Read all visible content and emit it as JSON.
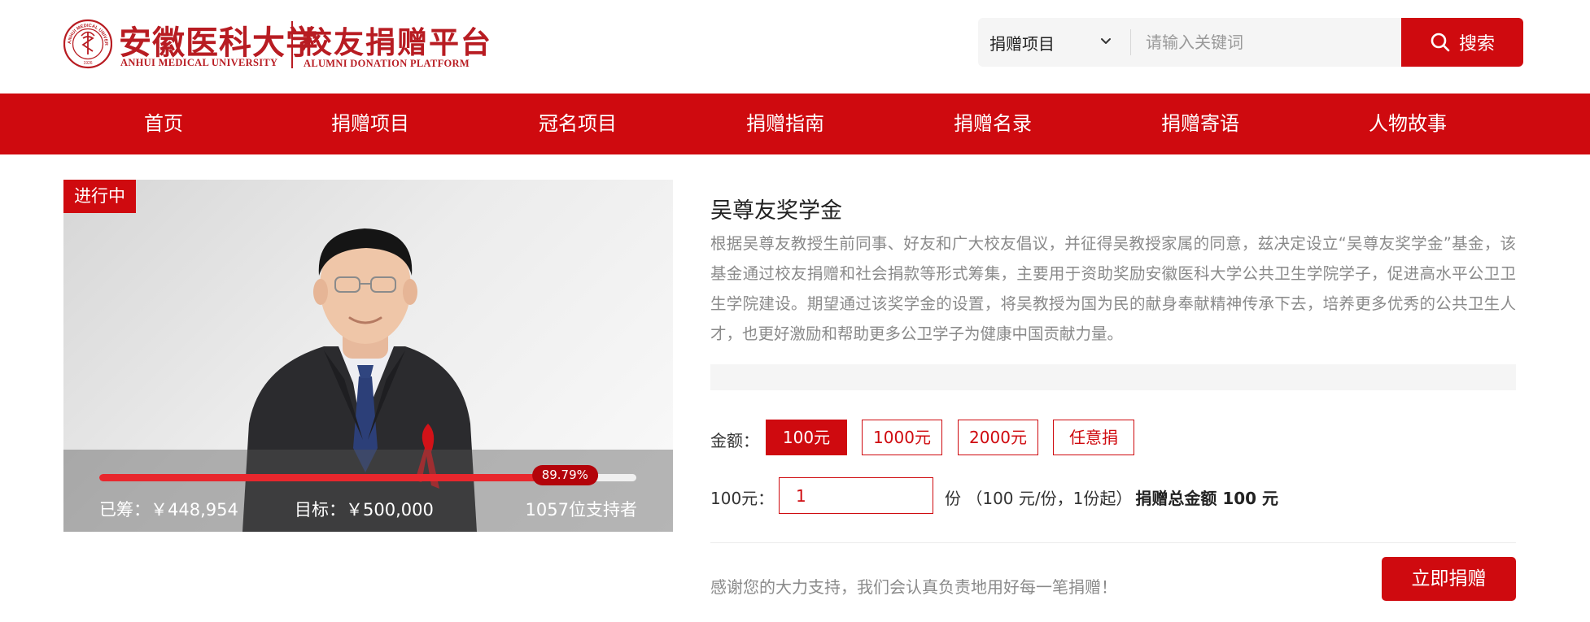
{
  "header": {
    "university_cn": "安徽医科大学",
    "university_en": "ANHUI MEDICAL UNIVERSITY",
    "platform_cn": "校友捐赠平台",
    "platform_en": "ALUMNI DONATION PLATFORM",
    "seal_ring_text": "ANHUI MEDICAL UNIVERSITY",
    "seal_year": "1926",
    "brand_color": "#b81c22"
  },
  "search": {
    "category_selected": "捐赠项目",
    "placeholder": "请输入关键词",
    "button_label": "搜索",
    "button_icon": "search-icon",
    "dropdown_icon": "chevron-down-icon"
  },
  "nav": {
    "items": [
      {
        "label": "首页"
      },
      {
        "label": "捐赠项目"
      },
      {
        "label": "冠名项目"
      },
      {
        "label": "捐赠指南"
      },
      {
        "label": "捐赠名录"
      },
      {
        "label": "捐赠寄语"
      },
      {
        "label": "人物故事"
      }
    ],
    "background_color": "#cf0a0f"
  },
  "project": {
    "status": "进行中",
    "progress_percent": 89.79,
    "progress_label": "89.79%",
    "raised": "已筹：￥448,954",
    "goal": "目标：￥500,000",
    "supporters": "1057位支持者",
    "title": "吴尊友奖学金",
    "description": "根据吴尊友教授生前同事、好友和广大校友倡议，并征得吴教授家属的同意，兹决定设立“吴尊友奖学金”基金，该基金通过校友捐赠和社会捐款等形式筹集，主要用于资助奖励安徽医科大学公共卫生学院学子，促进高水平公卫卫生学院建设。期望通过该奖学金的设置，将吴教授为国为民的献身奉献精神传承下去，培养更多优秀的公共卫生人才，也更好激励和帮助更多公卫学子为健康中国贡献力量。"
  },
  "donation": {
    "amount_label": "金额：",
    "options": [
      {
        "label": "100元",
        "selected": true
      },
      {
        "label": "1000元",
        "selected": false
      },
      {
        "label": "2000元",
        "selected": false
      },
      {
        "label": "任意捐",
        "selected": false
      }
    ],
    "unit_label": "100元：",
    "quantity_value": "1",
    "unit_suffix": "份 （100 元/份，1份起）",
    "total_label": "捐赠总金额 100 元",
    "thanks_text": "感谢您的大力支持，我们会认真负责地用好每一笔捐赠！",
    "donate_button": "立即捐赠",
    "accent_color": "#cf0a0f"
  }
}
